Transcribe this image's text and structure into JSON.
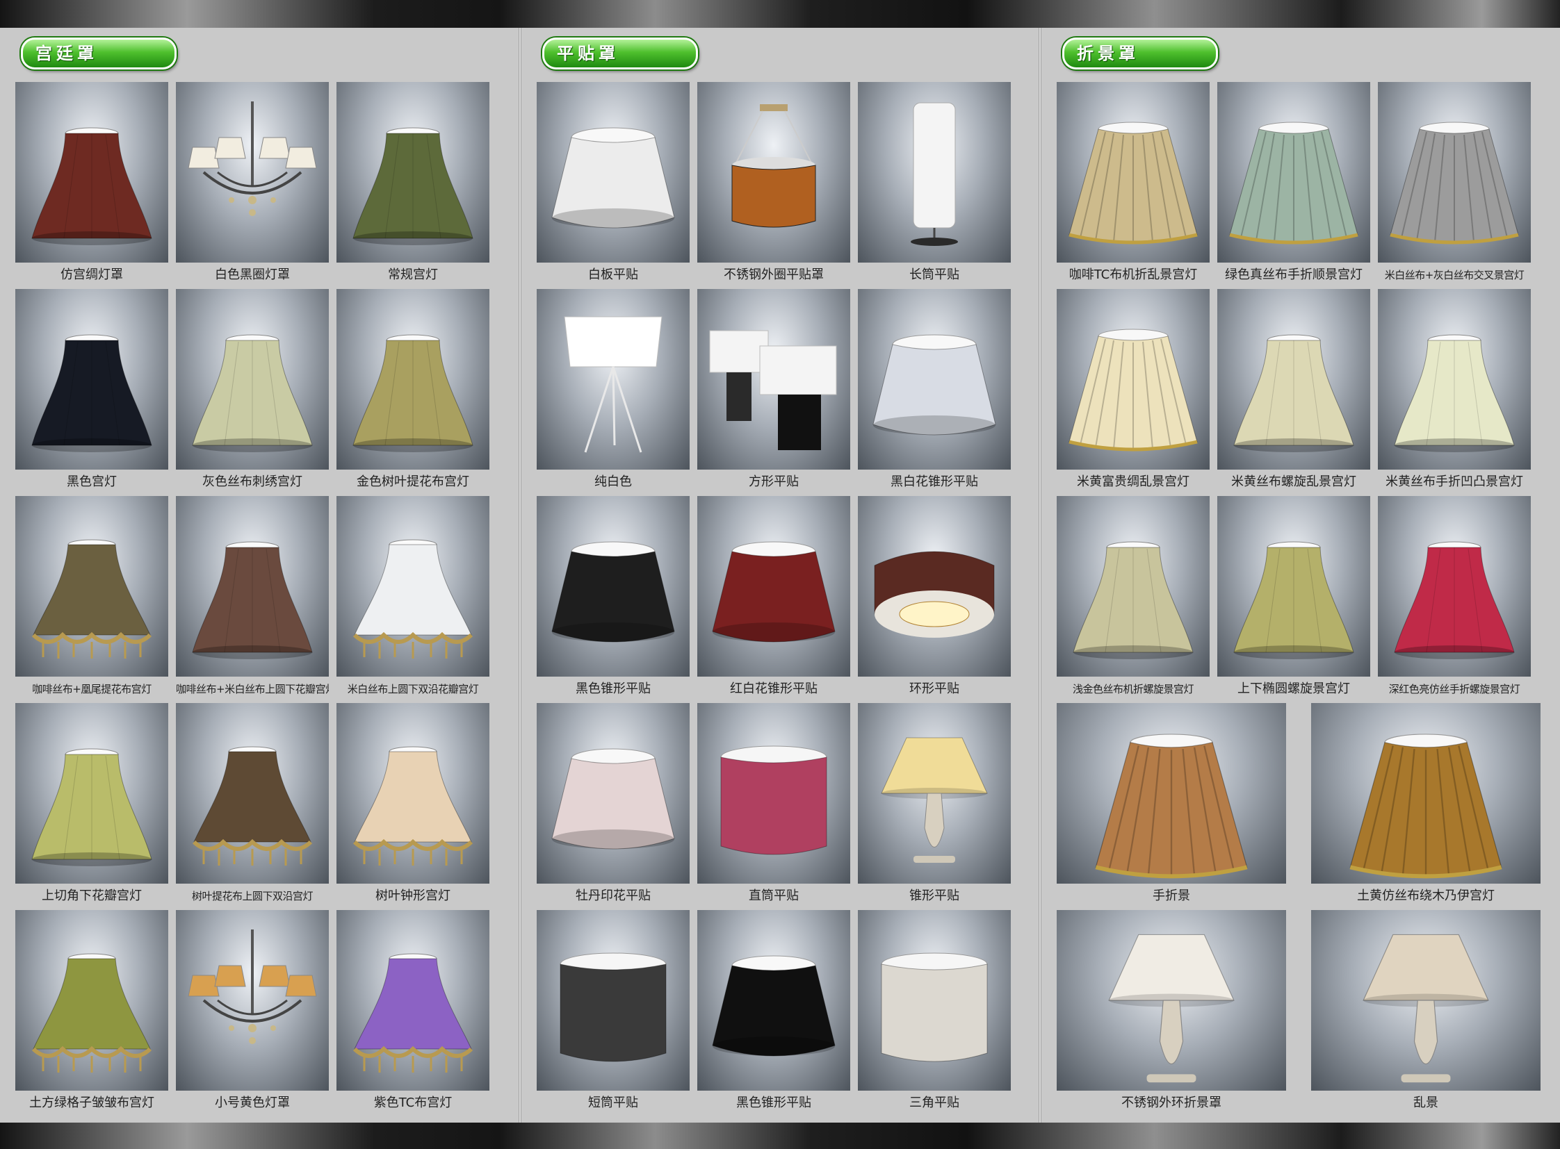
{
  "sections": [
    {
      "title": "宫廷罩",
      "items": [
        {
          "caption": "仿宫绸灯罩",
          "icon": "bell-shade-icon",
          "color": "#6e2a22"
        },
        {
          "caption": "白色黑圈灯罩",
          "icon": "chandelier-icon",
          "color": "#f2ede0"
        },
        {
          "caption": "常规宫灯",
          "icon": "bell-shade-icon",
          "color": "#5d6a3a"
        },
        {
          "caption": "黑色宫灯",
          "icon": "bell-shade-icon",
          "color": "#161a24"
        },
        {
          "caption": "灰色丝布刺绣宫灯",
          "icon": "bell-shade-icon",
          "color": "#c9cba4"
        },
        {
          "caption": "金色树叶提花布宫灯",
          "icon": "bell-shade-icon",
          "color": "#a9a060"
        },
        {
          "caption": "咖啡丝布+凰尾提花布宫灯",
          "icon": "fringed-shade-icon",
          "color": "#6b6040"
        },
        {
          "caption": "咖啡丝布+米白丝布上圆下花瓣宫灯",
          "icon": "bell-shade-icon",
          "color": "#6a4a3e"
        },
        {
          "caption": "米白丝布上圆下双沿花瓣宫灯",
          "icon": "fringed-shade-icon",
          "color": "#eef0f2"
        },
        {
          "caption": "上切角下花瓣宫灯",
          "icon": "bell-shade-icon",
          "color": "#b9bc6a"
        },
        {
          "caption": "树叶提花布上圆下双沿宫灯",
          "icon": "fringed-shade-icon",
          "color": "#5e4a34"
        },
        {
          "caption": "树叶钟形宫灯",
          "icon": "fringed-shade-icon",
          "color": "#e8d2b4"
        },
        {
          "caption": "土方绿格子皱皱布宫灯",
          "icon": "fringed-shade-icon",
          "color": "#8e9640"
        },
        {
          "caption": "小号黄色灯罩",
          "icon": "chandelier-icon",
          "color": "#d8a050"
        },
        {
          "caption": "紫色TC布宫灯",
          "icon": "fringed-shade-icon",
          "color": "#8c62c4"
        }
      ]
    },
    {
      "title": "平贴罩",
      "items": [
        {
          "caption": "白板平贴",
          "icon": "drum-shade-icon",
          "color": "#ececec"
        },
        {
          "caption": "不锈钢外圈平贴罩",
          "icon": "pendant-lamp-icon",
          "color": "#b06020"
        },
        {
          "caption": "长筒平贴",
          "icon": "tall-cylinder-lamp-icon",
          "color": "#f4f4f4"
        },
        {
          "caption": "纯白色",
          "icon": "tripod-lamp-icon",
          "color": "#ffffff"
        },
        {
          "caption": "方形平贴",
          "icon": "square-table-lamp-icon",
          "color": "#f4f4f4"
        },
        {
          "caption": "黑白花锥形平贴",
          "icon": "drum-shade-icon",
          "color": "#d8dce4"
        },
        {
          "caption": "黑色锥形平贴",
          "icon": "drum-shade-icon",
          "color": "#1e1e1e"
        },
        {
          "caption": "红白花锥形平贴",
          "icon": "drum-shade-icon",
          "color": "#7a2020"
        },
        {
          "caption": "环形平贴",
          "icon": "ring-shade-icon",
          "color": "#5a2a22"
        },
        {
          "caption": "牡丹印花平贴",
          "icon": "drum-shade-icon",
          "color": "#e4d4d4"
        },
        {
          "caption": "直筒平贴",
          "icon": "cylinder-shade-icon",
          "color": "#b04060"
        },
        {
          "caption": "锥形平贴",
          "icon": "table-lamp-icon",
          "color": "#f0dc98"
        },
        {
          "caption": "短筒平贴",
          "icon": "cylinder-shade-icon",
          "color": "#3a3a3a"
        },
        {
          "caption": "黑色锥形平贴",
          "icon": "drum-shade-icon",
          "color": "#101010"
        },
        {
          "caption": "三角平贴",
          "icon": "cylinder-shade-icon",
          "color": "#dcd8d0"
        }
      ]
    },
    {
      "title": "折景罩",
      "items": [
        {
          "caption": "咖啡TC布机折乱景宫灯",
          "icon": "pleated-shade-icon",
          "color": "#cdbb8c"
        },
        {
          "caption": "绿色真丝布手折顺景宫灯",
          "icon": "pleated-shade-icon",
          "color": "#9cb4a4"
        },
        {
          "caption": "米白丝布+灰白丝布交叉景宫灯",
          "icon": "pleated-shade-icon",
          "color": "#9c9c9c"
        },
        {
          "caption": "米黄富贵绸乱景宫灯",
          "icon": "pleated-shade-icon",
          "color": "#ede2bc"
        },
        {
          "caption": "米黄丝布螺旋乱景宫灯",
          "icon": "bell-shade-icon",
          "color": "#dcd8b4"
        },
        {
          "caption": "米黄丝布手折凹凸景宫灯",
          "icon": "bell-shade-icon",
          "color": "#e6e8c8"
        },
        {
          "caption": "浅金色丝布机折螺旋景宫灯",
          "icon": "bell-shade-icon",
          "color": "#c8c49c"
        },
        {
          "caption": "上下椭圆螺旋景宫灯",
          "icon": "bell-shade-icon",
          "color": "#b4b06a"
        },
        {
          "caption": "深红色亮仿丝手折螺旋景宫灯",
          "icon": "bell-shade-icon",
          "color": "#c02a48"
        },
        {
          "caption": "手折景",
          "icon": "pleated-shade-icon",
          "color": "#b47c48"
        },
        {
          "caption": "土黄仿丝布绕木乃伊宫灯",
          "icon": "pleated-shade-icon",
          "color": "#a8782c"
        },
        {
          "caption": "不锈钢外环折景罩",
          "icon": "table-lamp-icon",
          "color": "#f0ece4"
        },
        {
          "caption": "乱景",
          "icon": "table-lamp-icon",
          "color": "#e0d4c0"
        }
      ]
    }
  ]
}
